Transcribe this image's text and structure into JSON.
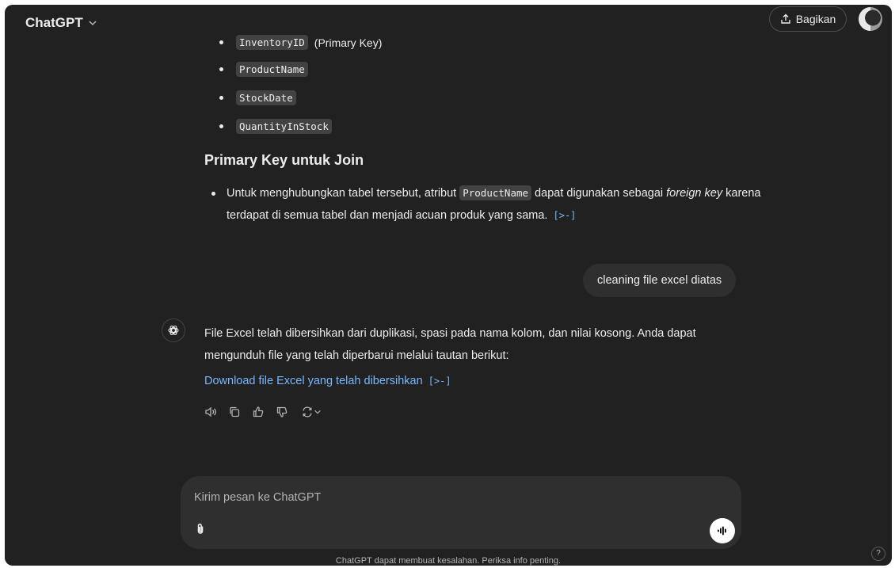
{
  "header": {
    "title": "ChatGPT",
    "share_label": "Bagikan"
  },
  "attributes": {
    "partial_item": "InventoryID",
    "partial_suffix": "(Primary Key)",
    "items": [
      "ProductName",
      "StockDate",
      "QuantityInStock"
    ]
  },
  "section": {
    "heading": "Primary Key untuk Join",
    "text_before": "Untuk menghubungkan tabel tersebut, atribut ",
    "code": "ProductName",
    "text_mid": " dapat digunakan sebagai ",
    "italic_1": "foreign",
    "italic_2": "key",
    "text_after": " karena terdapat di semua tabel dan menjadi acuan produk yang sama.",
    "citation": "[>-]"
  },
  "user_message": "cleaning file excel diatas",
  "assistant": {
    "text": "File Excel telah dibersihkan dari duplikasi, spasi pada nama kolom, dan nilai kosong. Anda dapat mengunduh file yang telah diperbarui melalui tautan berikut:",
    "link_label": "Download file Excel yang telah dibersihkan",
    "citation": "[>-]"
  },
  "actions": [
    "read-aloud-icon",
    "copy-icon",
    "thumbs-up-icon",
    "thumbs-down-icon",
    "regenerate-icon"
  ],
  "composer": {
    "placeholder": "Kirim pesan ke ChatGPT"
  },
  "footer": {
    "disclaimer": "ChatGPT dapat membuat kesalahan. Periksa info penting.",
    "help": "?"
  },
  "colors": {
    "background": "#212121",
    "bubble": "#2f2f2f",
    "link": "#7ab7ff",
    "code_bg": "#424242"
  }
}
